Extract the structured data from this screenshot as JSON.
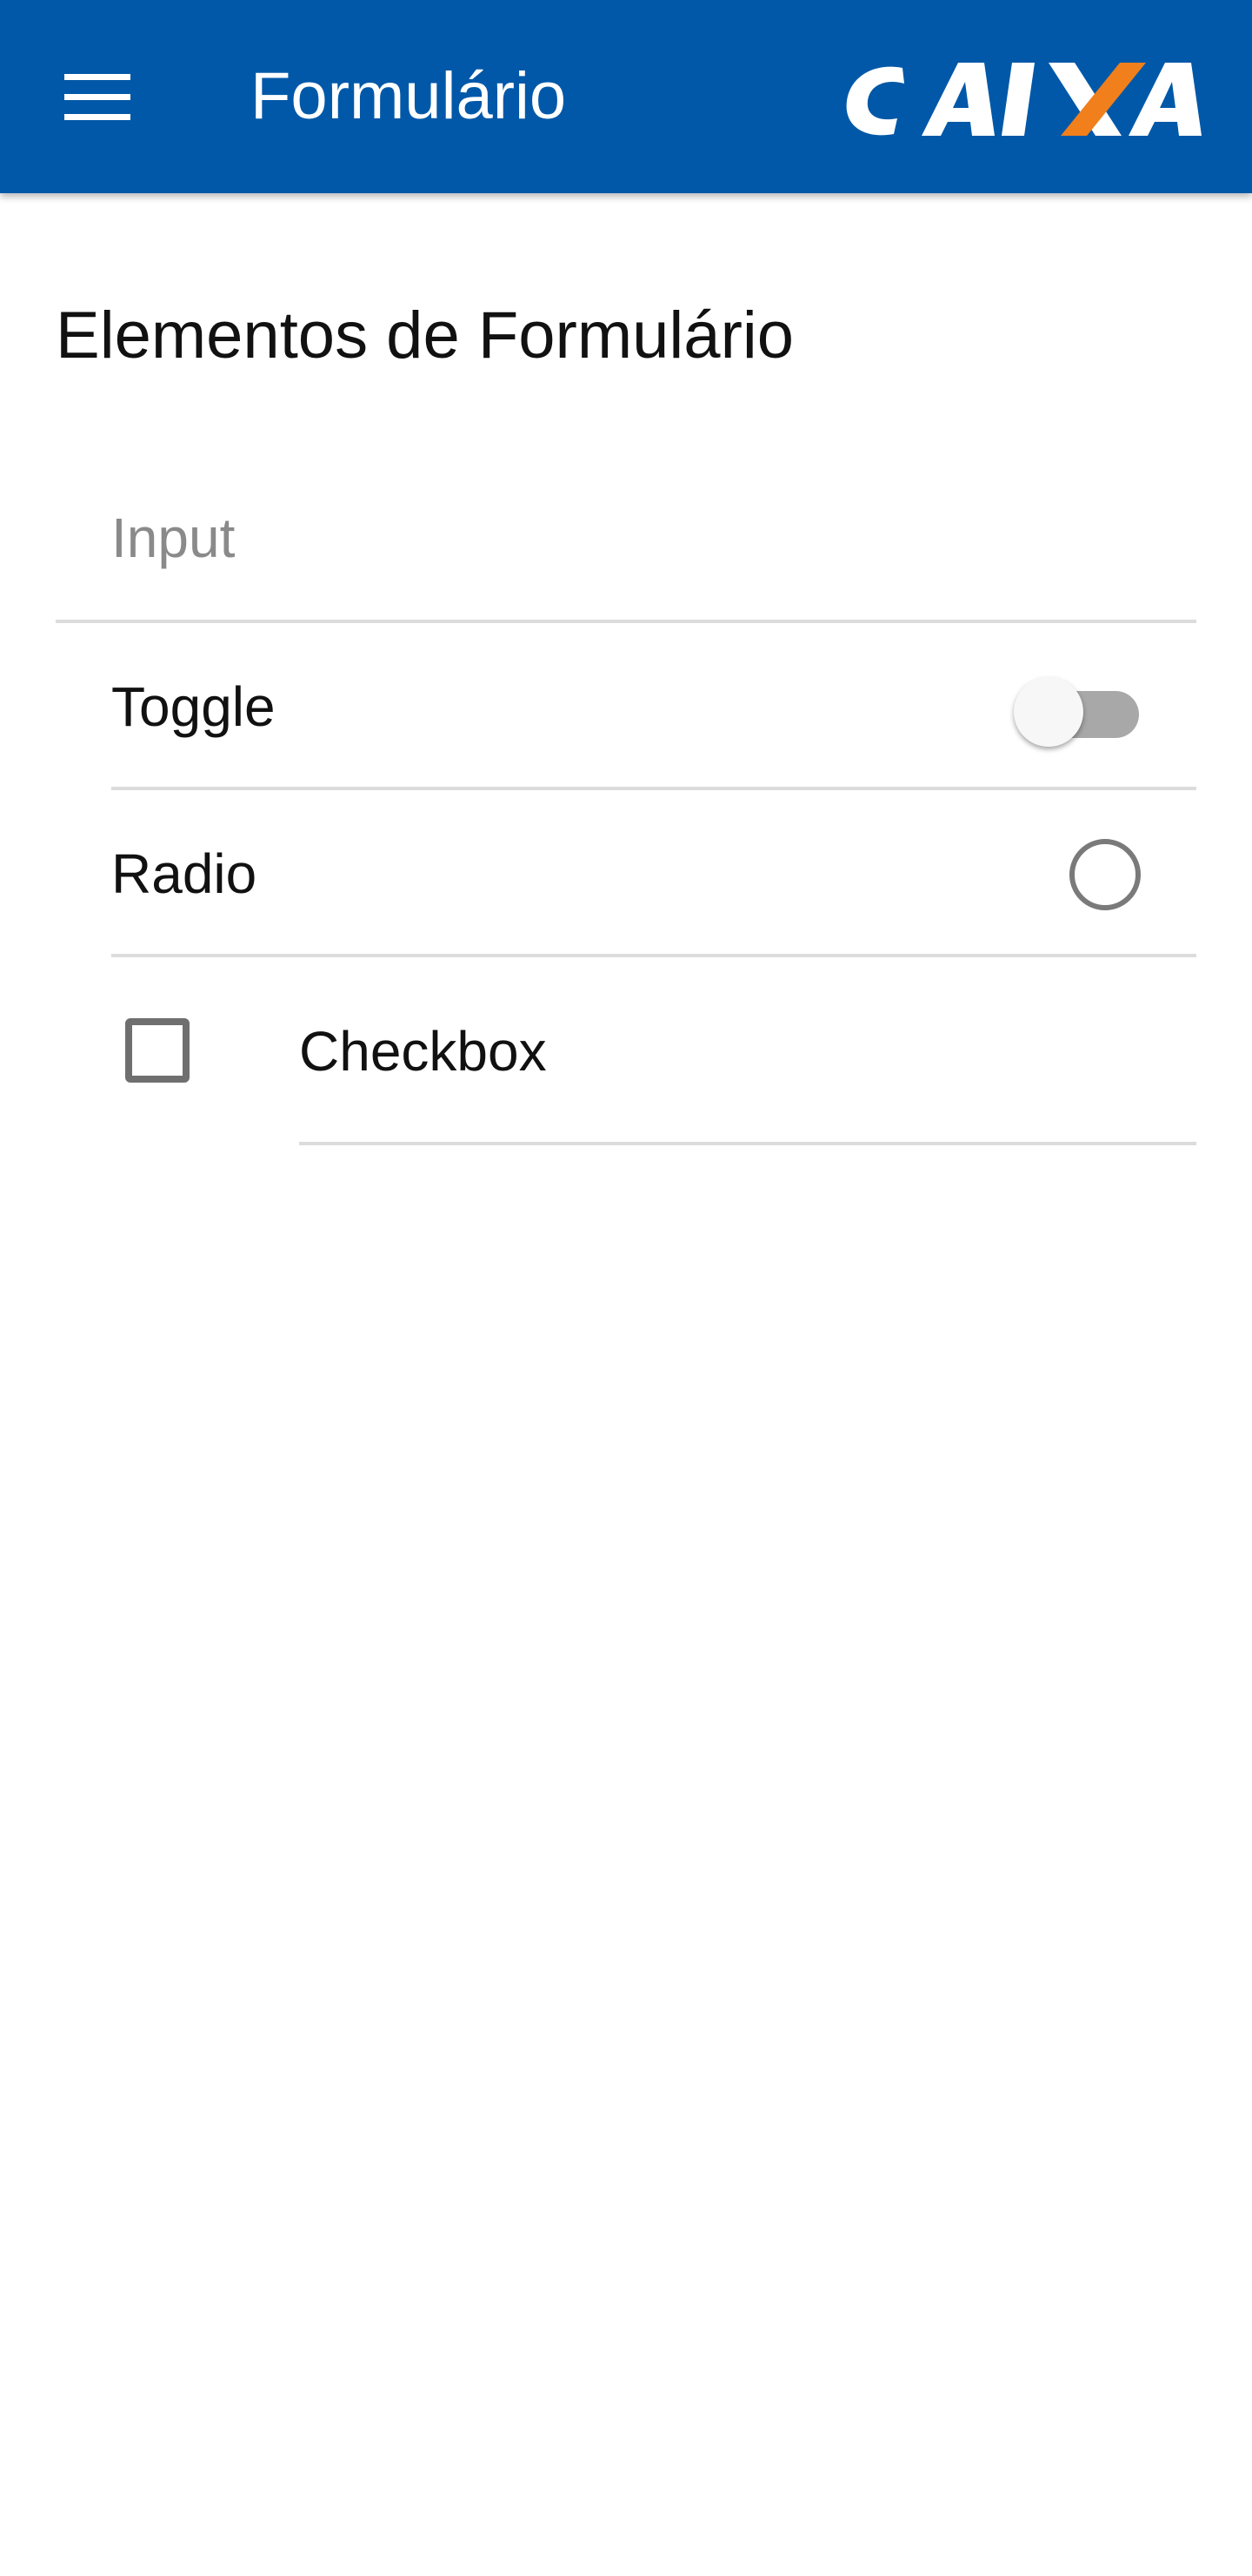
{
  "toolbar": {
    "title": "Formulário",
    "menu_icon": "hamburger-menu-icon",
    "logo": "CAIXA",
    "background": "#0158a8",
    "logo_accent": "#f07f1c"
  },
  "page": {
    "heading": "Elementos de Formulário"
  },
  "form": {
    "input": {
      "placeholder": "Input",
      "value": ""
    },
    "toggle": {
      "label": "Toggle",
      "checked": false
    },
    "radio": {
      "label": "Radio",
      "checked": false
    },
    "checkbox": {
      "label": "Checkbox",
      "checked": false
    }
  }
}
